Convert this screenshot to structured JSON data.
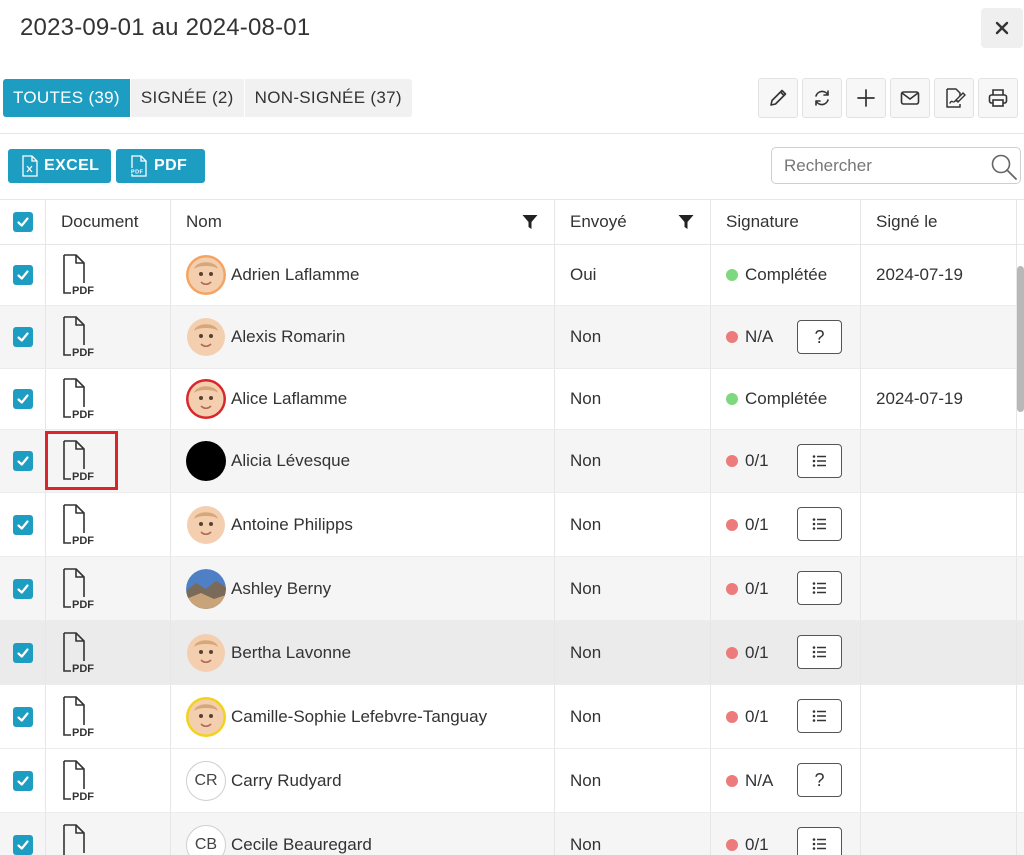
{
  "header": {
    "title": "2023-09-01 au 2024-08-01",
    "close_icon": "close-icon"
  },
  "tabs": [
    {
      "label": "TOUTES (39)",
      "active": true
    },
    {
      "label": "SIGNÉE (2)",
      "active": false
    },
    {
      "label": "NON-SIGNÉE (37)",
      "active": false
    }
  ],
  "toolbar": [
    "pencil-icon",
    "refresh-icon",
    "plus-icon",
    "envelope-icon",
    "sign-document-icon",
    "printer-icon"
  ],
  "export": {
    "excel_label": "EXCEL",
    "pdf_label": "PDF"
  },
  "search": {
    "placeholder": "Rechercher",
    "value": ""
  },
  "table": {
    "columns": [
      "Document",
      "Nom",
      "Envoyé",
      "Signature",
      "Signé le"
    ],
    "rows": [
      {
        "name": "Adrien Laflamme",
        "sent": "Oui",
        "sig": "Complétée",
        "status": "green",
        "signed": "2024-07-19",
        "btn": "",
        "avatar": "photo",
        "ring": "#f4a460",
        "bg": "#fff"
      },
      {
        "name": "Alexis Romarin",
        "sent": "Non",
        "sig": "N/A",
        "status": "red",
        "signed": "",
        "btn": "?",
        "avatar": "photo",
        "ring": "",
        "bg": "#f5f5f5"
      },
      {
        "name": "Alice Laflamme",
        "sent": "Non",
        "sig": "Complétée",
        "status": "green",
        "signed": "2024-07-19",
        "btn": "",
        "avatar": "photo",
        "ring": "#d9262b",
        "bg": "#fff"
      },
      {
        "name": "Alicia Lévesque",
        "sent": "Non",
        "sig": "0/1",
        "status": "red",
        "signed": "",
        "btn": "list",
        "avatar": "black",
        "ring": "",
        "bg": "#f5f5f5"
      },
      {
        "name": "Antoine Philipps",
        "sent": "Non",
        "sig": "0/1",
        "status": "red",
        "signed": "",
        "btn": "list",
        "avatar": "photo",
        "ring": "",
        "bg": "#fff"
      },
      {
        "name": "Ashley Berny",
        "sent": "Non",
        "sig": "0/1",
        "status": "red",
        "signed": "",
        "btn": "list",
        "avatar": "landscape",
        "ring": "",
        "bg": "#f5f5f5"
      },
      {
        "name": "Bertha Lavonne",
        "sent": "Non",
        "sig": "0/1",
        "status": "red",
        "signed": "",
        "btn": "list",
        "avatar": "photo",
        "ring": "",
        "bg": "#ebebeb"
      },
      {
        "name": "Camille-Sophie Lefebvre-Tanguay",
        "sent": "Non",
        "sig": "0/1",
        "status": "red",
        "signed": "",
        "btn": "list",
        "avatar": "photo",
        "ring": "#f2d21b",
        "bg": "#fff"
      },
      {
        "name": "Carry Rudyard",
        "sent": "Non",
        "sig": "N/A",
        "status": "red",
        "signed": "",
        "btn": "?",
        "avatar": "CR",
        "ring": "",
        "bg": "#fff"
      },
      {
        "name": "Cecile Beauregard",
        "sent": "Non",
        "sig": "0/1",
        "status": "red",
        "signed": "",
        "btn": "list",
        "avatar": "CB",
        "ring": "",
        "bg": "#f5f5f5"
      }
    ]
  },
  "colors": {
    "accent": "#1e9dc3",
    "status_green": "#7ed87e",
    "status_red": "#ee7b7b",
    "highlight": "#d9262b"
  }
}
